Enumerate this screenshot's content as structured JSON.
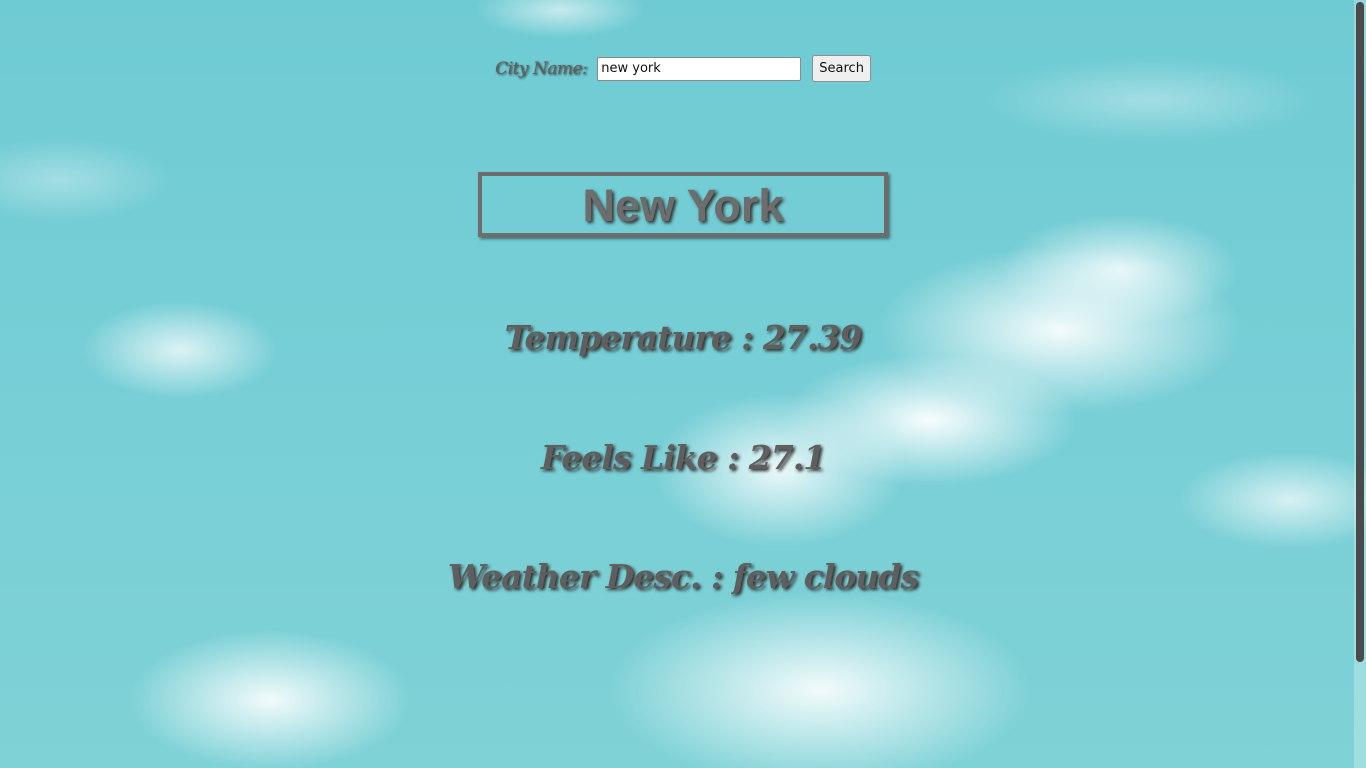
{
  "search": {
    "label": "City Name:",
    "value": "new york",
    "button_label": "Search"
  },
  "weather": {
    "city": "New York",
    "temperature_text": "Temperature : 27.39",
    "feels_like_text": "Feels Like : 27.1",
    "description_text": "Weather Desc. : few clouds"
  }
}
